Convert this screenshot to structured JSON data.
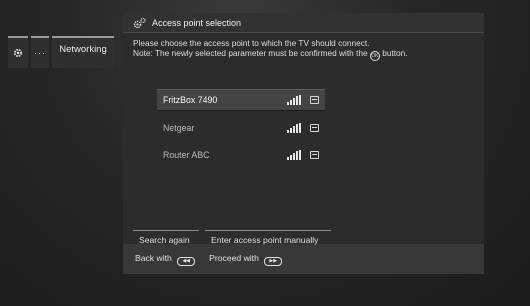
{
  "breadcrumb": {
    "items": [
      {
        "icon": "gear-icon"
      },
      {
        "label": "···"
      },
      {
        "label": "Networking"
      }
    ]
  },
  "dialog": {
    "title": "Access point selection",
    "title_icon": "settings-gears-icon",
    "instruction_line1": "Please choose the access point to which the TV should connect.",
    "instruction_line2_pre": "Note: The newly selected parameter must be confirmed with the",
    "instruction_line2_post": "button.",
    "ok_glyph": "OK",
    "access_points": [
      {
        "name": "FritzBox 7490",
        "selected": true,
        "signal_level": 4,
        "secured": true
      },
      {
        "name": "Netgear",
        "selected": false,
        "signal_level": 4,
        "secured": true
      },
      {
        "name": "Router ABC",
        "selected": false,
        "signal_level": 4,
        "secured": true
      }
    ],
    "actions": {
      "search_again": "Search again",
      "enter_manually": "Enter access point manually"
    },
    "footer": {
      "back_label": "Back with",
      "back_key": "◀◀",
      "proceed_label": "Proceed with",
      "proceed_key": "▶▶"
    }
  },
  "colors": {
    "background": "#232323",
    "selected_row": "#444444"
  }
}
